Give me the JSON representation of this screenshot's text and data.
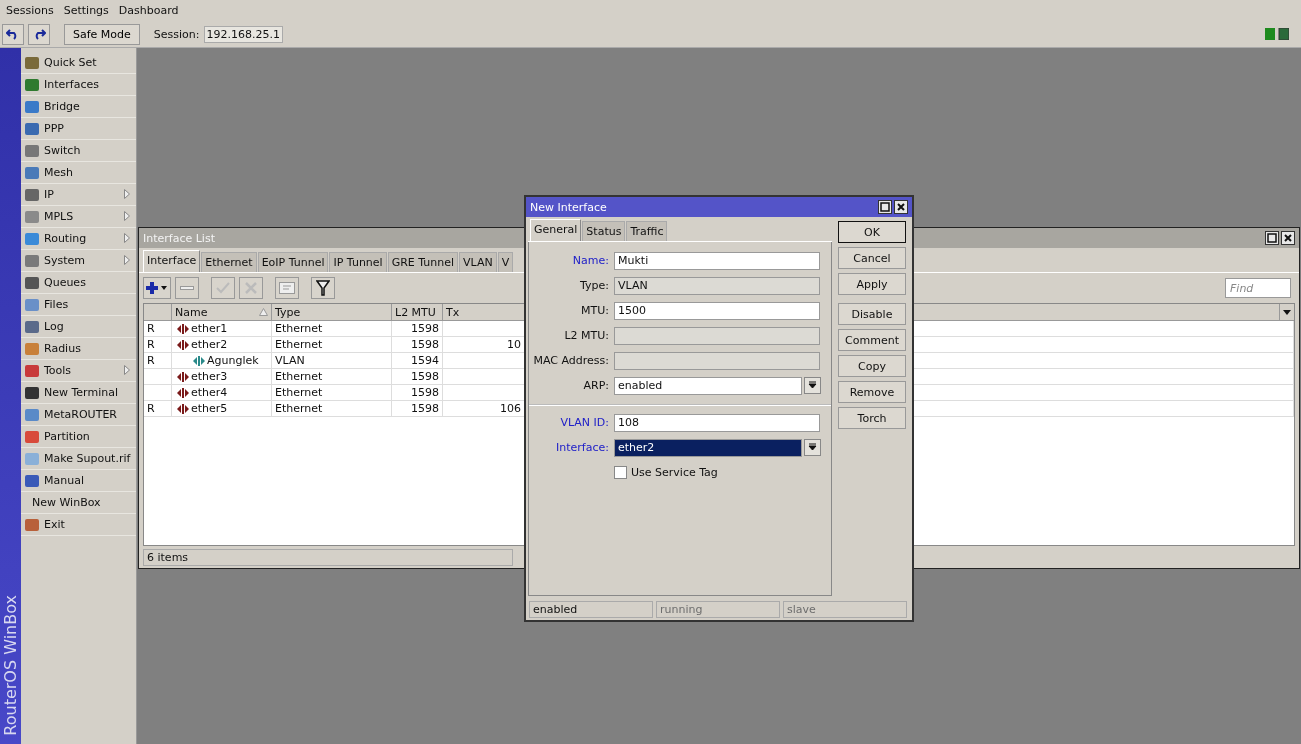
{
  "menubar": [
    "Sessions",
    "Settings",
    "Dashboard"
  ],
  "toolbar": {
    "safe_mode": "Safe Mode",
    "session_label": "Session:",
    "session_value": "192.168.25.1"
  },
  "sidebar": {
    "brand": "RouterOS WinBox",
    "items": [
      {
        "label": "Quick Set",
        "has_icon": true,
        "submenu": false
      },
      {
        "label": "Interfaces",
        "has_icon": true,
        "submenu": false
      },
      {
        "label": "Bridge",
        "has_icon": true,
        "submenu": false
      },
      {
        "label": "PPP",
        "has_icon": true,
        "submenu": false
      },
      {
        "label": "Switch",
        "has_icon": true,
        "submenu": false
      },
      {
        "label": "Mesh",
        "has_icon": true,
        "submenu": false
      },
      {
        "label": "IP",
        "has_icon": true,
        "submenu": true
      },
      {
        "label": "MPLS",
        "has_icon": true,
        "submenu": true
      },
      {
        "label": "Routing",
        "has_icon": true,
        "submenu": true
      },
      {
        "label": "System",
        "has_icon": true,
        "submenu": true
      },
      {
        "label": "Queues",
        "has_icon": true,
        "submenu": false
      },
      {
        "label": "Files",
        "has_icon": true,
        "submenu": false
      },
      {
        "label": "Log",
        "has_icon": true,
        "submenu": false
      },
      {
        "label": "Radius",
        "has_icon": true,
        "submenu": false
      },
      {
        "label": "Tools",
        "has_icon": true,
        "submenu": true
      },
      {
        "label": "New Terminal",
        "has_icon": true,
        "submenu": false
      },
      {
        "label": "MetaROUTER",
        "has_icon": true,
        "submenu": false
      },
      {
        "label": "Partition",
        "has_icon": true,
        "submenu": false
      },
      {
        "label": "Make Supout.rif",
        "has_icon": true,
        "submenu": false
      },
      {
        "label": "Manual",
        "has_icon": true,
        "submenu": false
      },
      {
        "label": "New WinBox",
        "has_icon": false,
        "submenu": false
      },
      {
        "label": "Exit",
        "has_icon": true,
        "submenu": false
      }
    ]
  },
  "interface_list": {
    "title": "Interface List",
    "tabs": [
      {
        "label": "Interface",
        "selected": true
      },
      {
        "label": "Ethernet",
        "selected": false
      },
      {
        "label": "EoIP Tunnel",
        "selected": false
      },
      {
        "label": "IP Tunnel",
        "selected": false
      },
      {
        "label": "GRE Tunnel",
        "selected": false
      },
      {
        "label": "VLAN",
        "selected": false
      },
      {
        "label": "V",
        "selected": false
      }
    ],
    "find": {
      "placeholder": "Find"
    },
    "columns": [
      {
        "label": "Name",
        "sorted": true
      },
      {
        "label": "Type",
        "sorted": false
      },
      {
        "label": "L2 MTU",
        "sorted": false
      },
      {
        "label": "Tx",
        "sorted": false
      }
    ],
    "rows": [
      {
        "flag": "R",
        "name": "ether1",
        "kind": "ethernet",
        "type": "Ethernet",
        "l2_mtu": "1598"
      },
      {
        "flag": "R",
        "name": "ether2",
        "kind": "ethernet",
        "type": "Ethernet",
        "l2_mtu": "1598",
        "tx": "10",
        "children": [
          {
            "flag": "R",
            "name": "Agunglek",
            "kind": "vlan",
            "type": "VLAN",
            "l2_mtu": "1594"
          }
        ]
      },
      {
        "name": "ether3",
        "kind": "ethernet",
        "type": "Ethernet",
        "l2_mtu": "1598"
      },
      {
        "name": "ether4",
        "kind": "ethernet",
        "type": "Ethernet",
        "l2_mtu": "1598"
      },
      {
        "flag": "R",
        "name": "ether5",
        "kind": "ethernet",
        "type": "Ethernet",
        "l2_mtu": "1598",
        "tx": "106"
      }
    ],
    "status": "6 items"
  },
  "dialog": {
    "title": "New Interface",
    "tabs": [
      {
        "label": "General",
        "selected": true
      },
      {
        "label": "Status",
        "selected": false
      },
      {
        "label": "Traffic",
        "selected": false
      }
    ],
    "fields": [
      {
        "kind": "text",
        "label": "Name:",
        "value": "Mukti",
        "required": true
      },
      {
        "kind": "readonly",
        "label": "Type:",
        "value": "VLAN",
        "required": false
      },
      {
        "kind": "text",
        "label": "MTU:",
        "value": "1500",
        "required": false
      },
      {
        "kind": "readonly",
        "label": "L2 MTU:",
        "required": false
      },
      {
        "kind": "readonly",
        "label": "MAC Address:",
        "required": false
      },
      {
        "kind": "select",
        "label": "ARP:",
        "value": "enabled",
        "required": false,
        "highlighted": false
      },
      {
        "kind": "separator"
      },
      {
        "kind": "text",
        "label": "VLAN ID:",
        "value": "108",
        "required": true
      },
      {
        "kind": "select",
        "label": "Interface:",
        "value": "ether2",
        "required": true,
        "highlighted": true
      },
      {
        "kind": "checkbox",
        "label": "Use Service Tag",
        "checked": false
      }
    ],
    "button_groups": [
      [
        {
          "label": "OK",
          "default": true
        },
        {
          "label": "Cancel",
          "default": false
        },
        {
          "label": "Apply",
          "default": false
        }
      ],
      [
        {
          "label": "Disable",
          "default": false
        },
        {
          "label": "Comment",
          "default": false
        },
        {
          "label": "Copy",
          "default": false
        },
        {
          "label": "Remove",
          "default": false
        },
        {
          "label": "Torch",
          "default": false
        }
      ]
    ],
    "status": [
      {
        "label": "enabled",
        "disabled": false
      },
      {
        "label": "running",
        "disabled": true
      },
      {
        "label": "slave",
        "disabled": true
      }
    ]
  }
}
